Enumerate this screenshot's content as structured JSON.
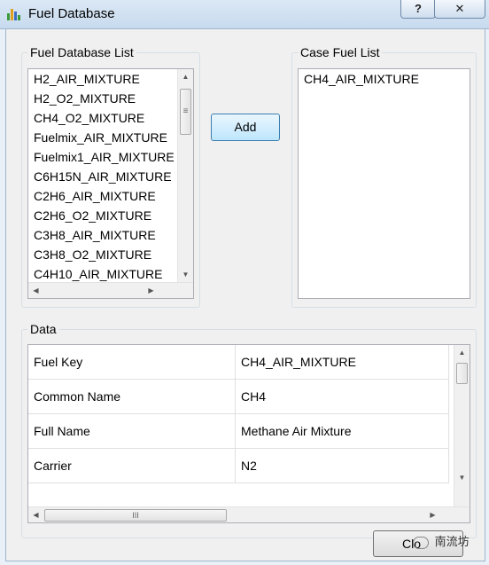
{
  "window": {
    "title": "Fuel Database",
    "help_label": "?",
    "close_label": "✕"
  },
  "fuel_db": {
    "label": "Fuel Database List",
    "items": [
      "H2_AIR_MIXTURE",
      "H2_O2_MIXTURE",
      "CH4_O2_MIXTURE",
      "Fuelmix_AIR_MIXTURE",
      "Fuelmix1_AIR_MIXTURE",
      "C6H15N_AIR_MIXTURE",
      "C2H6_AIR_MIXTURE",
      "C2H6_O2_MIXTURE",
      "C3H8_AIR_MIXTURE",
      "C3H8_O2_MIXTURE",
      "C4H10_AIR_MIXTURE"
    ],
    "scroll_grip": "≡"
  },
  "add_button": {
    "label": "Add"
  },
  "case_fuel": {
    "label": "Case Fuel List",
    "items": [
      "CH4_AIR_MIXTURE"
    ]
  },
  "data_group": {
    "label": "Data",
    "rows": [
      {
        "key": "Fuel Key",
        "value": "CH4_AIR_MIXTURE"
      },
      {
        "key": "Common Name",
        "value": "CH4"
      },
      {
        "key": "Full Name",
        "value": "Methane Air Mixture"
      },
      {
        "key": "Carrier",
        "value": "N2"
      }
    ],
    "scroll_grip": "III"
  },
  "close_button": {
    "label": "Clo"
  },
  "watermark": {
    "text": "南流坊"
  }
}
